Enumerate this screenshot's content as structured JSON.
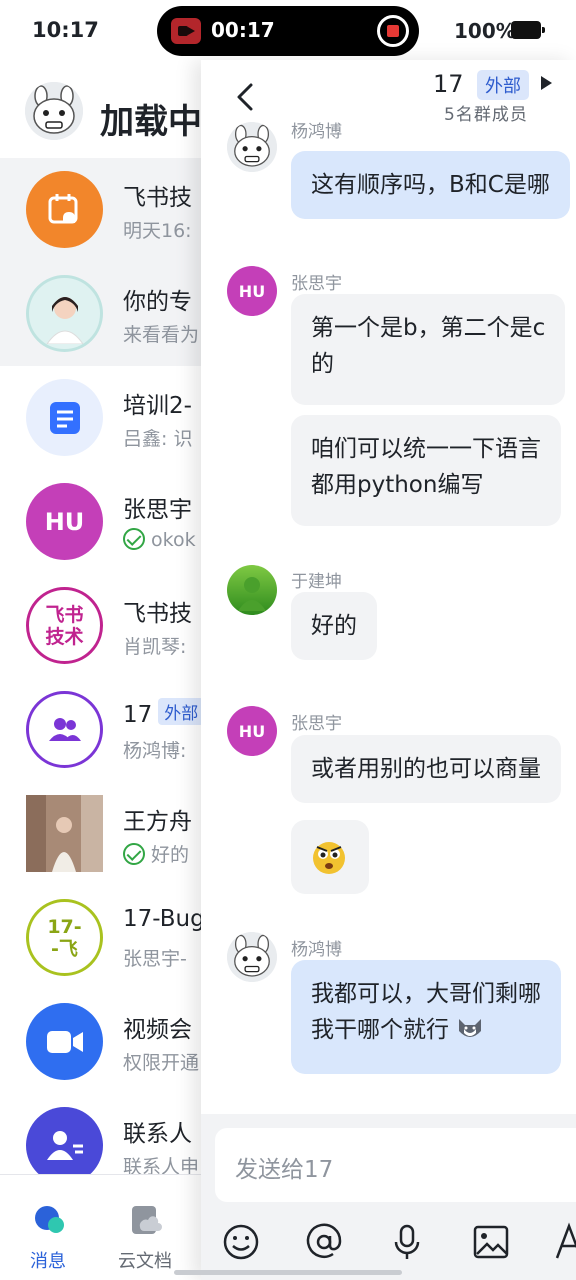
{
  "status_bar": {
    "time": "10:17",
    "recording_time": "00:17",
    "battery": "100%"
  },
  "list": {
    "header_title": "加载中",
    "rows": [
      {
        "name": "飞书技",
        "preview": "明天16:"
      },
      {
        "name": "你的专",
        "preview": "来看看为"
      },
      {
        "name": "培训2-",
        "preview": "吕鑫: 识"
      },
      {
        "name": "张思宇",
        "preview": "okok",
        "avatar_text": "HU"
      },
      {
        "name": "飞书技",
        "preview": "肖凯琴:",
        "avatar_text": "飞书\n技术"
      },
      {
        "name": "17",
        "tag": "外部",
        "preview": "杨鸿博:"
      },
      {
        "name": "王方舟",
        "preview": "好的"
      },
      {
        "name": "17-Bug",
        "preview": "张思宇-",
        "avatar_text": "17-\n-飞"
      },
      {
        "name": "视频会",
        "preview": "权限开通"
      },
      {
        "name": "联系人",
        "preview": "联系人申"
      }
    ]
  },
  "bottom_nav": {
    "messages": "消息",
    "docs": "云文档"
  },
  "chat": {
    "title": "17",
    "title_tag": "外部",
    "subtitle": "5名群成员",
    "messages": [
      {
        "sender": "杨鸿博",
        "text": "这有顺序吗，B和C是哪"
      },
      {
        "sender": "张思宇",
        "avatar_text": "HU",
        "text": "第一个是b，第二个是c",
        "text2": "的"
      },
      {
        "text": "咱们可以统一一下语言",
        "text2": "都用python编写"
      },
      {
        "sender": "于建坤",
        "text": "好的"
      },
      {
        "sender": "张思宇",
        "avatar_text": "HU",
        "text": "或者用别的也可以商量"
      },
      {
        "emoji": "owl-face"
      },
      {
        "sender": "杨鸿博",
        "text": "我都可以，大哥们剩哪",
        "text2": "我干哪个就行"
      }
    ],
    "input_placeholder": "发送给17"
  },
  "colors": {
    "accent": "#2b62d9",
    "bubble_blue": "#d9e7fc",
    "bubble_gray": "#f2f3f5",
    "hu_purple": "#c43fb8"
  }
}
